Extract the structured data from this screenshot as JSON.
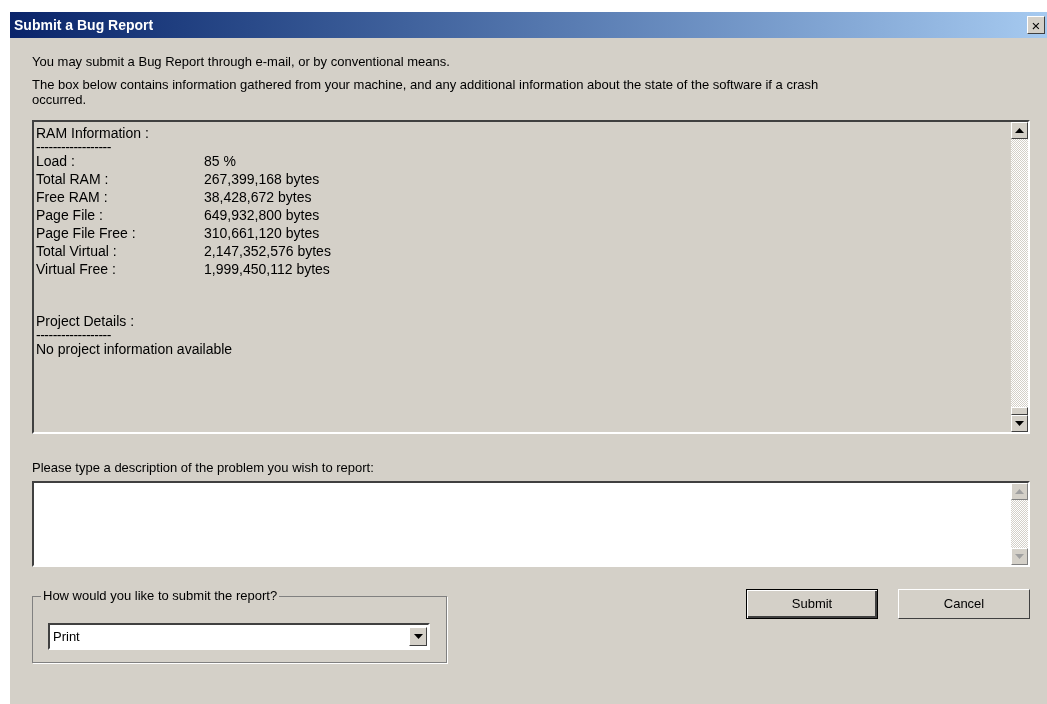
{
  "window": {
    "title": "Submit a Bug Report",
    "close": "×"
  },
  "intro": [
    "You may submit a Bug Report through e-mail, or by conventional means.",
    "The box below contains information gathered from your machine, and any additional information about the state of the software if a crash occurred."
  ],
  "info_box": {
    "lines": [
      {
        "kind": "text",
        "text": "RAM Information :"
      },
      {
        "kind": "rule",
        "text": "------------------"
      },
      {
        "kind": "pair",
        "label": "Load :",
        "value": "85 %"
      },
      {
        "kind": "pair",
        "label": "Total RAM :",
        "value": "267,399,168 bytes"
      },
      {
        "kind": "pair",
        "label": "Free RAM :",
        "value": "38,428,672 bytes"
      },
      {
        "kind": "pair",
        "label": "Page File :",
        "value": "649,932,800 bytes"
      },
      {
        "kind": "pair",
        "label": "Page File Free :",
        "value": "310,661,120 bytes"
      },
      {
        "kind": "pair",
        "label": "Total Virtual :",
        "value": "2,147,352,576 bytes"
      },
      {
        "kind": "pair",
        "label": "Virtual Free :",
        "value": "1,999,450,112 bytes"
      },
      {
        "kind": "gap"
      },
      {
        "kind": "text",
        "text": "Project Details :"
      },
      {
        "kind": "rule",
        "text": "------------------"
      },
      {
        "kind": "text",
        "text": "No project information available"
      }
    ]
  },
  "description": {
    "label": "Please type a description of the problem you wish to report:"
  },
  "submit_method": {
    "legend": "How would you like to submit the report?",
    "value": "Print"
  },
  "buttons": [
    {
      "label": "Submit",
      "default": true
    },
    {
      "label": "Cancel",
      "default": false
    }
  ]
}
